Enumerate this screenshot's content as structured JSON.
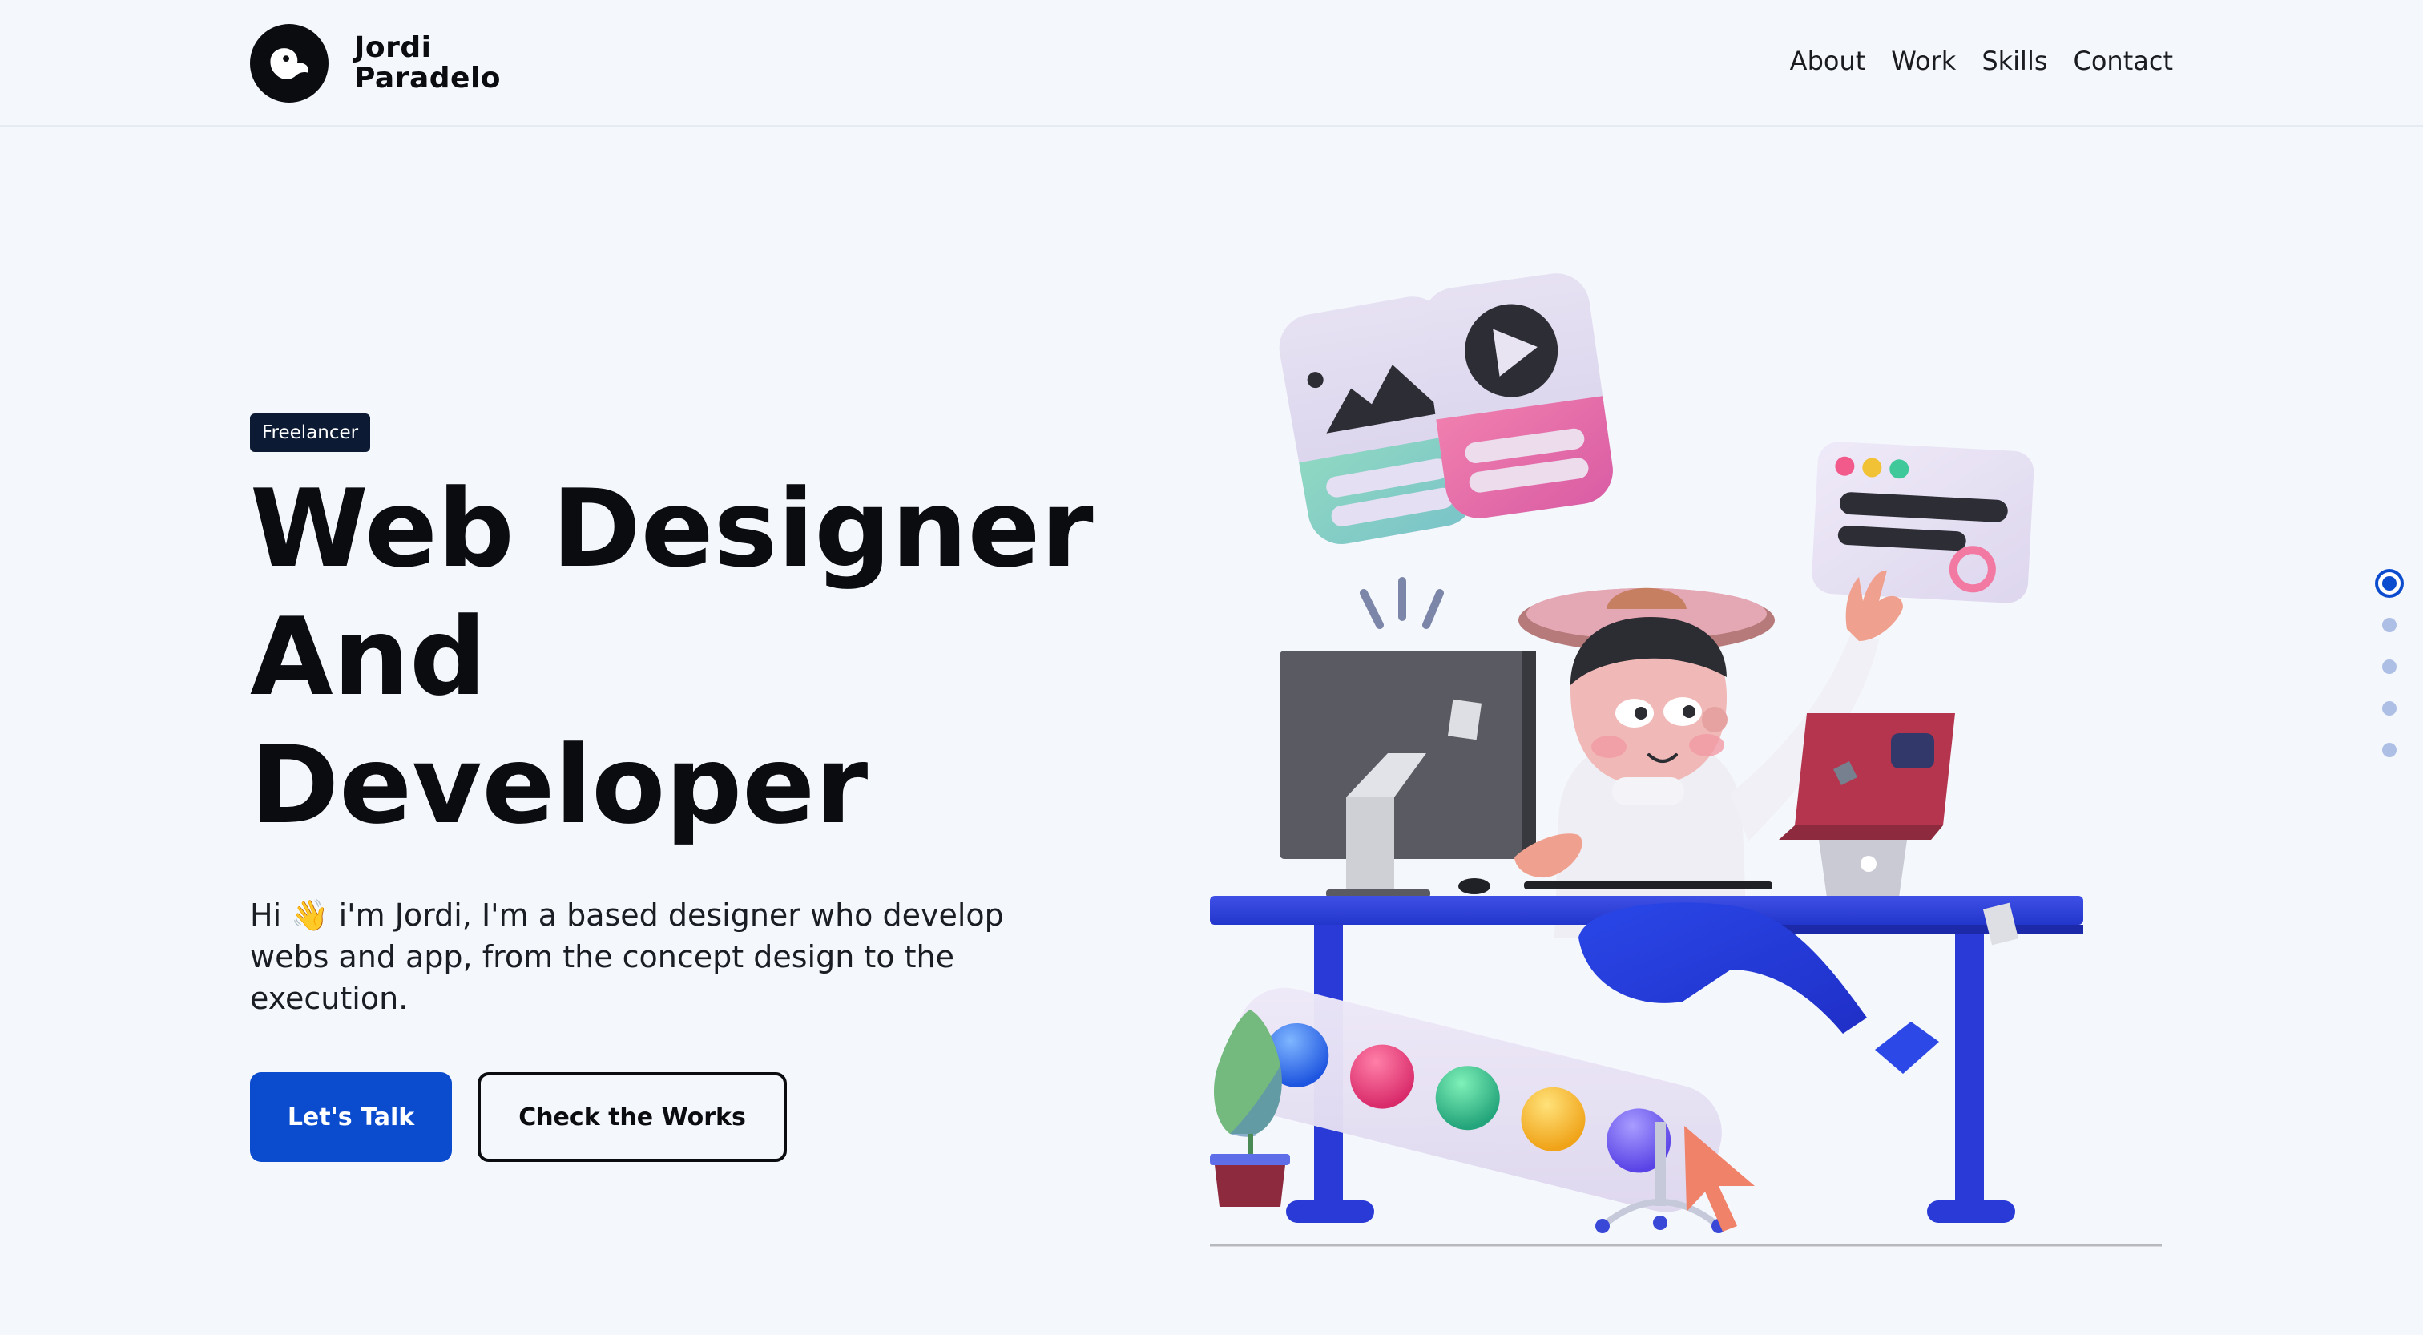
{
  "header": {
    "logo_line1": "Jordi",
    "logo_line2": "Paradelo",
    "nav": [
      "About",
      "Work",
      "Skills",
      "Contact"
    ]
  },
  "hero": {
    "badge": "Freelancer",
    "title_lines": [
      "Web Designer",
      "And",
      "Developer"
    ],
    "intro": "Hi 👋  i'm Jordi, I'm a based designer who develop webs and app, from the concept design to the execution.",
    "primary_button": "Let's Talk",
    "secondary_button": "Check the Works",
    "illustration": "3d-developer-at-desk-illustration"
  },
  "slide_nav": {
    "count": 5,
    "active_index": 0
  },
  "colors": {
    "background": "#f4f7fc",
    "accent": "#0b4ccf",
    "text": "#0b0c10",
    "badge": "#0d1a33"
  }
}
